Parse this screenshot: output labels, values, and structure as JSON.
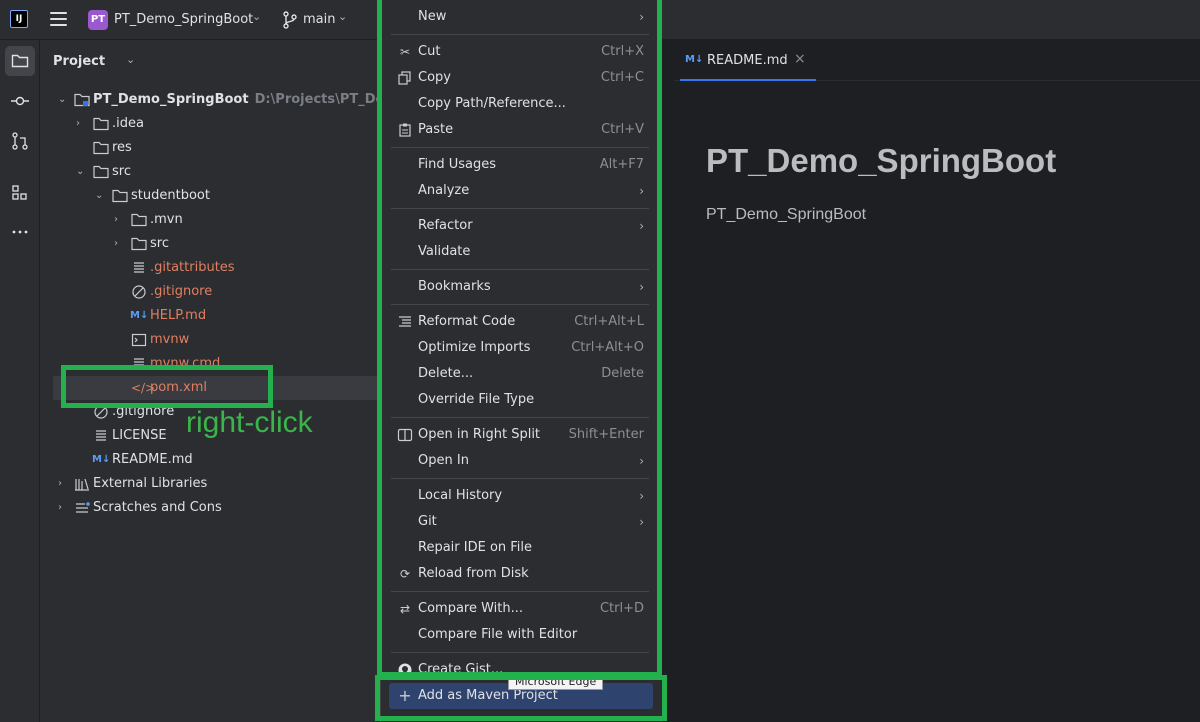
{
  "titlebar": {
    "app_logo": "IJ",
    "project_badge": "PT",
    "project_name": "PT_Demo_SpringBoot",
    "branch": "main"
  },
  "project_panel": {
    "title": "Project",
    "tree": [
      {
        "label": "PT_Demo_SpringBoot",
        "path": "D:\\Projects\\PT_Demo_S"
      },
      {
        "label": ".idea"
      },
      {
        "label": "res"
      },
      {
        "label": "src"
      },
      {
        "label": "studentboot"
      },
      {
        "label": ".mvn"
      },
      {
        "label": "src"
      },
      {
        "label": ".gitattributes"
      },
      {
        "label": ".gitignore"
      },
      {
        "label": "HELP.md"
      },
      {
        "label": "mvnw"
      },
      {
        "label": "mvnw.cmd"
      },
      {
        "label": "pom.xml"
      },
      {
        "label": ".gitignore"
      },
      {
        "label": "LICENSE"
      },
      {
        "label": "README.md"
      },
      {
        "label": "External Libraries"
      },
      {
        "label": "Scratches and Cons"
      }
    ],
    "md_badge": "M↓"
  },
  "annotation": {
    "text": "right-click",
    "color": "#22b14c"
  },
  "editor": {
    "tab_label": "README.md",
    "heading": "PT_Demo_SpringBoot",
    "paragraph": "PT_Demo_SpringBoot"
  },
  "context_menu": {
    "items": [
      {
        "label": "New",
        "shortcut": ""
      },
      {
        "label": "Cut",
        "shortcut": "Ctrl+X"
      },
      {
        "label": "Copy",
        "shortcut": "Ctrl+C"
      },
      {
        "label": "Copy Path/Reference...",
        "shortcut": ""
      },
      {
        "label": "Paste",
        "shortcut": "Ctrl+V"
      },
      {
        "label": "Find Usages",
        "shortcut": "Alt+F7"
      },
      {
        "label": "Analyze",
        "shortcut": ""
      },
      {
        "label": "Refactor",
        "shortcut": ""
      },
      {
        "label": "Validate",
        "shortcut": ""
      },
      {
        "label": "Bookmarks",
        "shortcut": ""
      },
      {
        "label": "Reformat Code",
        "shortcut": "Ctrl+Alt+L"
      },
      {
        "label": "Optimize Imports",
        "shortcut": "Ctrl+Alt+O"
      },
      {
        "label": "Delete...",
        "shortcut": "Delete"
      },
      {
        "label": "Override File Type",
        "shortcut": ""
      },
      {
        "label": "Open in Right Split",
        "shortcut": "Shift+Enter"
      },
      {
        "label": "Open In",
        "shortcut": ""
      },
      {
        "label": "Local History",
        "shortcut": ""
      },
      {
        "label": "Git",
        "shortcut": ""
      },
      {
        "label": "Repair IDE on File",
        "shortcut": ""
      },
      {
        "label": "Reload from Disk",
        "shortcut": ""
      },
      {
        "label": "Compare With...",
        "shortcut": "Ctrl+D"
      },
      {
        "label": "Compare File with Editor",
        "shortcut": ""
      },
      {
        "label": "Create Gist...",
        "shortcut": ""
      },
      {
        "label": "Add as Maven Project",
        "shortcut": ""
      }
    ],
    "submenu_glyph": "›",
    "tooltip": "Microsoft Edge"
  }
}
